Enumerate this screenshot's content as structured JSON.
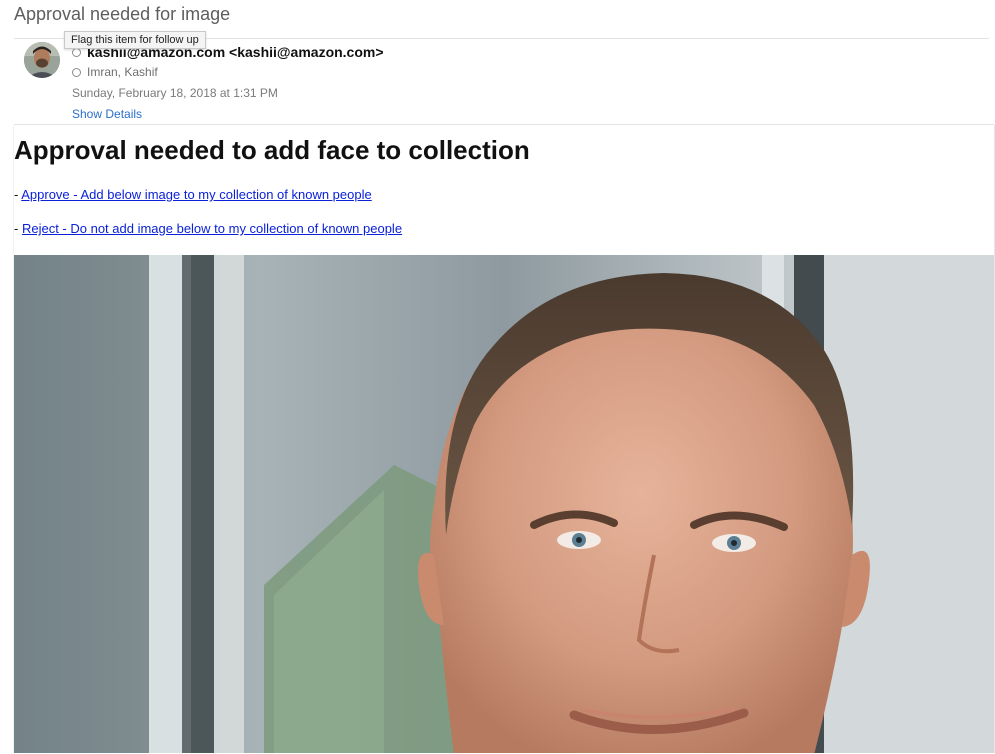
{
  "email": {
    "subject": "Approval needed for image",
    "tooltip": "Flag this item for follow up",
    "from": "kashii@amazon.com <kashii@amazon.com>",
    "to": "Imran, Kashif",
    "date": "Sunday, February 18, 2018 at 1:31 PM",
    "show_details": "Show Details"
  },
  "body": {
    "heading": "Approval needed to add face to collection",
    "approve_prefix": "- ",
    "approve_link": "Approve - Add below image to my collection of known people",
    "reject_prefix": "- ",
    "reject_link": "Reject - Do not add image below to my collection of known people"
  },
  "icons": {
    "sender_status": "circle-icon",
    "recipient_status": "circle-icon"
  },
  "colors": {
    "link": "#0b21d9",
    "details_link": "#2a6fca",
    "subject_text": "#5e5e5e"
  }
}
